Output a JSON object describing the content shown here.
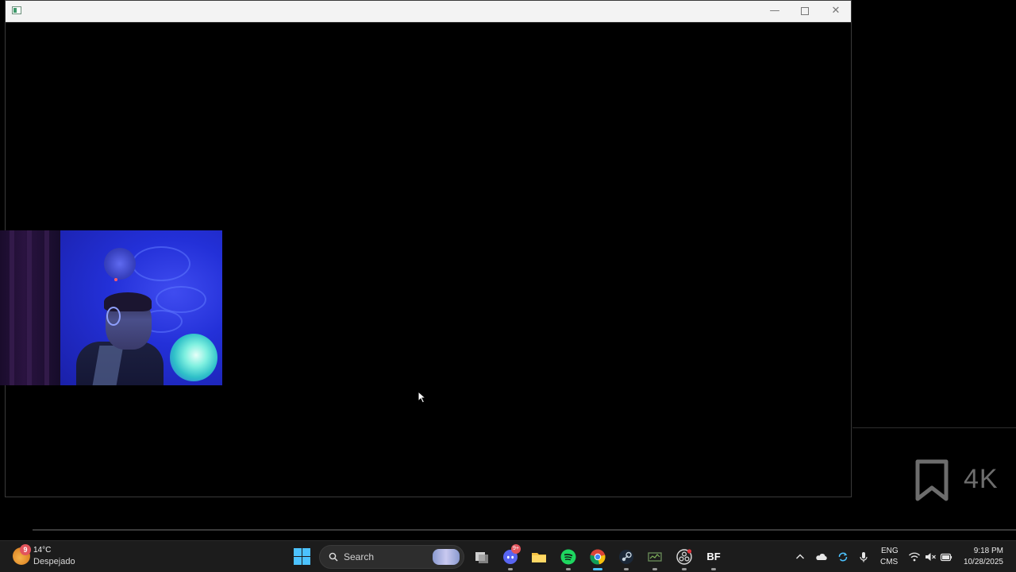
{
  "window": {
    "title": "",
    "minimize_glyph": "—",
    "close_glyph": "✕"
  },
  "overlay": {
    "quality_label": "4K"
  },
  "taskbar": {
    "weather": {
      "badge": "9",
      "temperature": "14°C",
      "condition": "Despejado"
    },
    "search": {
      "placeholder": "Search"
    },
    "apps": [
      {
        "name": "task-view-icon"
      },
      {
        "name": "discord-icon",
        "badge": "9+"
      },
      {
        "name": "file-explorer-icon"
      },
      {
        "name": "spotify-icon"
      },
      {
        "name": "chrome-icon"
      },
      {
        "name": "steam-icon"
      },
      {
        "name": "monitor-app-icon"
      },
      {
        "name": "obs-icon"
      },
      {
        "name": "bf-icon",
        "label": "BF"
      }
    ],
    "tray": {
      "lang_top": "ENG",
      "lang_bottom": "CMS",
      "time": "9:18 PM",
      "date": "10/28/2025"
    }
  },
  "colors": {
    "accent": "#4cc2ff",
    "taskbar": "#1c1c1c",
    "titlebar": "#f3f3f3"
  }
}
